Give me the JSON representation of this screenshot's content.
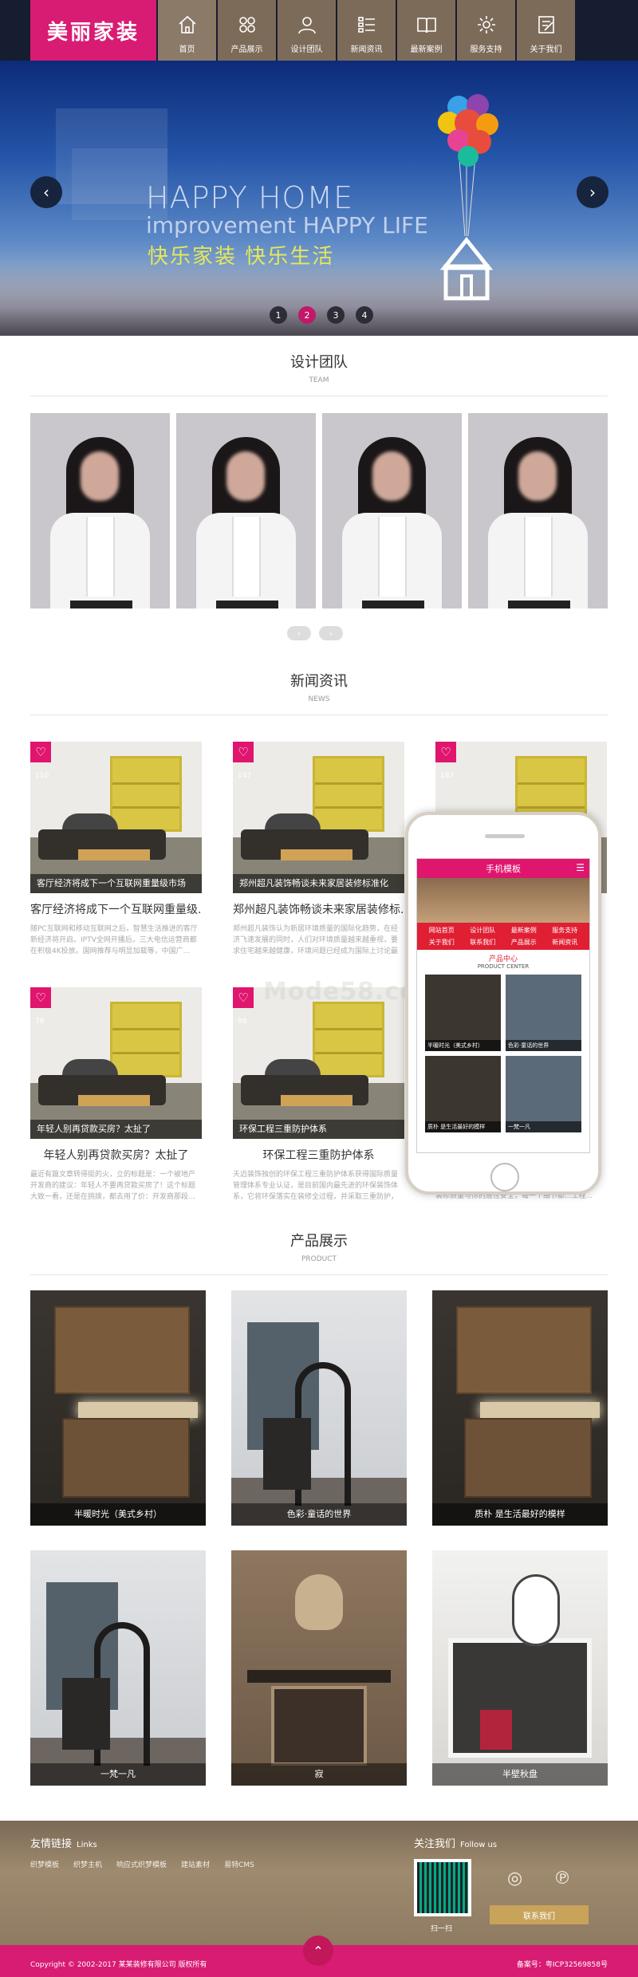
{
  "header": {
    "logo": "美丽家装",
    "nav": [
      {
        "label": "首页",
        "icon": "home-icon"
      },
      {
        "label": "产品展示",
        "icon": "grid-icon"
      },
      {
        "label": "设计团队",
        "icon": "user-icon"
      },
      {
        "label": "新闻资讯",
        "icon": "list-icon"
      },
      {
        "label": "最新案例",
        "icon": "book-icon"
      },
      {
        "label": "服务支持",
        "icon": "gear-icon"
      },
      {
        "label": "关于我们",
        "icon": "edit-icon"
      }
    ]
  },
  "banner": {
    "line1": "HAPPY HOME",
    "line2": "improvement HAPPY LIFE",
    "line3": "快乐家装  快乐生活",
    "prev": "‹",
    "next": "›",
    "dots": [
      "1",
      "2",
      "3",
      "4"
    ],
    "active_dot": 2
  },
  "team": {
    "title": "设计团队",
    "subtitle": "TEAM",
    "pager_prev": "‹",
    "pager_next": "›"
  },
  "news": {
    "title": "新闻资讯",
    "subtitle": "NEWS",
    "items": [
      {
        "count": "110",
        "caption": "客厅经济将成下一个互联网重量级市场",
        "title": "客厅经济将成下一个互联网重量级...",
        "desc": "随PC互联网和移动互联网之后，智慧生活推进的客厅新经济将开启。IPTV全网开播后，三大电信运营商都在积极4K投放。国网推荐与明显加载等，中国广..."
      },
      {
        "count": "147",
        "caption": "郑州超凡装饰畅谈未来家居装修标准化",
        "title": "郑州超凡装饰畅谈未来家居装修标...",
        "desc": "郑州超凡装饰认为新居环境质量的国际化趋势，在经济飞速发展的同时，人们对环境质量越来越重视，要求住宅越来越健康，环境问题已经成为国际上讨论最多的话..."
      },
      {
        "count": "187",
        "caption": "",
        "title": "",
        "desc": ""
      },
      {
        "count": "78",
        "caption": "年轻人别再贷款买房？太扯了",
        "title": "年轻人别再贷款买房？太扯了",
        "desc": "最近有篇文章转得挺的火，立的标题是：一个被地产开发商的建议：年轻人不要再贷款买房了！这个标题大致一看，还是在挑拨，都去用了价：开发商那段..."
      },
      {
        "count": "98",
        "caption": "环保工程三重防护体系",
        "title": "环保工程三重防护体系",
        "desc": "天迈装饰独创的环保工程三重防护体系获得国际质量管理体系专业认证，是目前国内最先进的环保装饰体系，它将环保落实在装修全过程，并采取三重防护，环..."
      },
      {
        "count": "",
        "caption": "",
        "title": "",
        "desc": "装修质量与你的居住安全，每一个细节都...工程..."
      }
    ]
  },
  "phone": {
    "title": "手机模板",
    "menu": [
      "网站首页",
      "设计团队",
      "最新案例",
      "服务支持",
      "关于我们",
      "联系我们",
      "产品展示",
      "新闻资讯"
    ],
    "center_zh": "产品中心",
    "center_en": "PRODUCT CENTER",
    "products": [
      "半暖时光（美式乡村）",
      "色彩·童话的世界",
      "质朴 是生活最好的模样",
      "一梵一凡"
    ]
  },
  "watermark": "Mode58.com",
  "products": {
    "title": "产品展示",
    "subtitle": "PRODUCT",
    "items": [
      {
        "label": "半暖时光（美式乡村）",
        "style": "cab"
      },
      {
        "label": "色彩·童话的世界",
        "style": "room"
      },
      {
        "label": "质朴 是生活最好的模样",
        "style": "cab"
      },
      {
        "label": "一梵一凡",
        "style": "room"
      },
      {
        "label": "寂",
        "style": "deer"
      },
      {
        "label": "半壁秋盘",
        "style": "white"
      }
    ]
  },
  "footer": {
    "links_title": "友情链接",
    "links_title_en": "Links",
    "links": [
      "织梦模板",
      "织梦主机",
      "响应式织梦模板",
      "建站素材",
      "易特CMS"
    ],
    "follow_title": "关注我们",
    "follow_title_en": "Follow us",
    "qr_label": "扫一扫",
    "weibo": "◎",
    "qq": "℗",
    "contact": "联系我们",
    "up": "⌃",
    "copyright": "Copyright © 2002-2017 某某装修有限公司 版权所有",
    "icp": "备案号：粤ICP32569858号"
  }
}
